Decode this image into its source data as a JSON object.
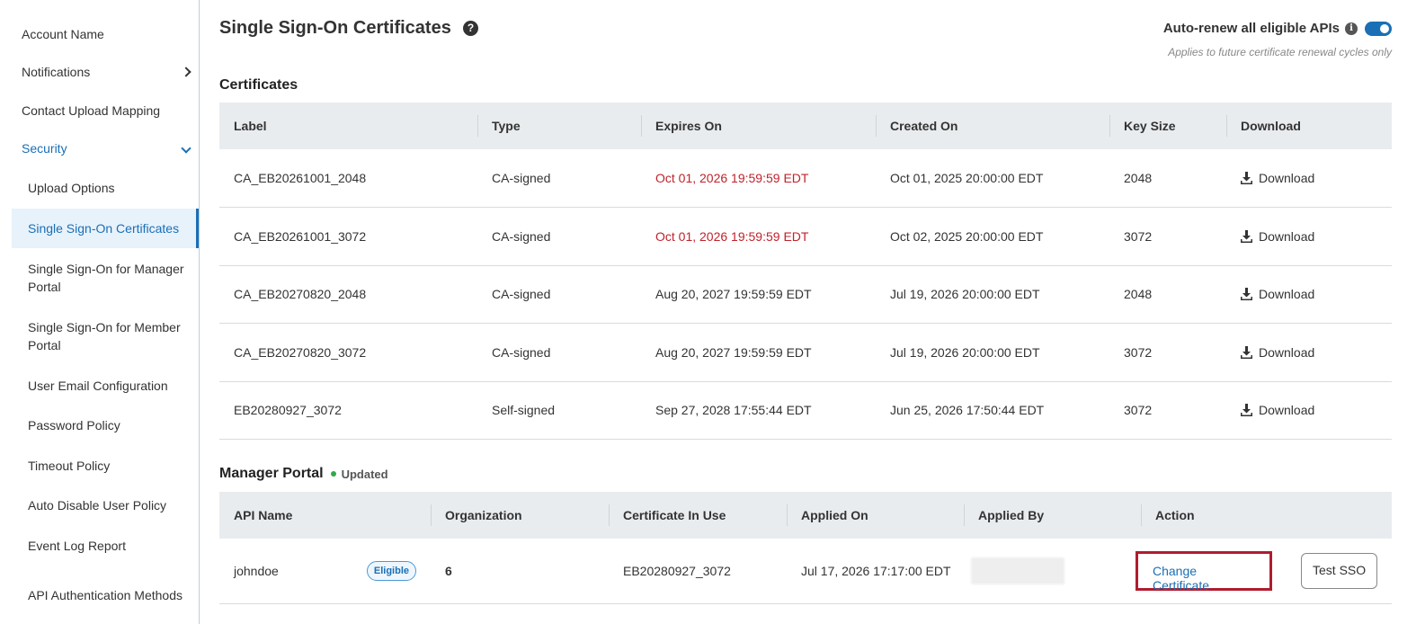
{
  "sidebar": {
    "items": [
      {
        "label": "Account Name"
      },
      {
        "label": "Notifications"
      },
      {
        "label": "Contact Upload Mapping"
      },
      {
        "label": "Security"
      },
      {
        "label": "Upload Options"
      },
      {
        "label": "Single Sign-On Certificates"
      },
      {
        "label": "Single Sign-On for Manager Portal"
      },
      {
        "label": "Single Sign-On for Member Portal"
      },
      {
        "label": "User Email Configuration"
      },
      {
        "label": "Password Policy"
      },
      {
        "label": "Timeout Policy"
      },
      {
        "label": "Auto Disable User Policy"
      },
      {
        "label": "Event Log Report"
      },
      {
        "label": "API Authentication Methods"
      }
    ]
  },
  "header": {
    "title": "Single Sign-On Certificates",
    "help_icon": "question-circle-icon",
    "autorenew_label": "Auto-renew all eligible APIs",
    "autorenew_enabled": true,
    "autorenew_note": "Applies to future certificate renewal cycles only"
  },
  "certificates": {
    "title": "Certificates",
    "columns": [
      "Label",
      "Type",
      "Expires On",
      "Created On",
      "Key Size",
      "Download"
    ],
    "rows": [
      {
        "label": "CA_EB20261001_2048",
        "type": "CA-signed",
        "expires": "Oct 01, 2026 19:59:59 EDT",
        "created": "Oct 01, 2025 20:00:00 EDT",
        "key_size": "2048",
        "download": "Download"
      },
      {
        "label": "CA_EB20261001_3072",
        "type": "CA-signed",
        "expires": "Oct 01, 2026 19:59:59 EDT",
        "created": "Oct 02, 2025 20:00:00 EDT",
        "key_size": "3072",
        "download": "Download"
      },
      {
        "label": "CA_EB20270820_2048",
        "type": "CA-signed",
        "expires": "Aug 20, 2027 19:59:59 EDT",
        "created": "Jul 19, 2026 20:00:00 EDT",
        "key_size": "2048",
        "download": "Download"
      },
      {
        "label": "CA_EB20270820_3072",
        "type": "CA-signed",
        "expires": "Aug 20, 2027 19:59:59 EDT",
        "created": "Jul 19, 2026 20:00:00 EDT",
        "key_size": "3072",
        "download": "Download"
      },
      {
        "label": "EB20280927_3072",
        "type": "Self-signed",
        "expires": "Sep 27, 2028 17:55:44 EDT",
        "created": "Jun 25, 2026 17:50:44 EDT",
        "key_size": "3072",
        "download": "Download"
      }
    ],
    "expiry_warning_color": "#c0222b"
  },
  "manager_portal": {
    "title": "Manager Portal",
    "status": "Updated",
    "status_color": "#2eaa4a",
    "columns": [
      "API Name",
      "Organization",
      "Certificate In Use",
      "Applied On",
      "Applied By",
      "Action"
    ],
    "rows": [
      {
        "api_name": "johndoe",
        "badge": "Eligible",
        "organization": "6",
        "certificate": "EB20280927_3072",
        "applied_on": "Jul 17, 2026 17:17:00 EDT",
        "change_label": "Change Certificate",
        "test_label": "Test SSO"
      }
    ]
  }
}
